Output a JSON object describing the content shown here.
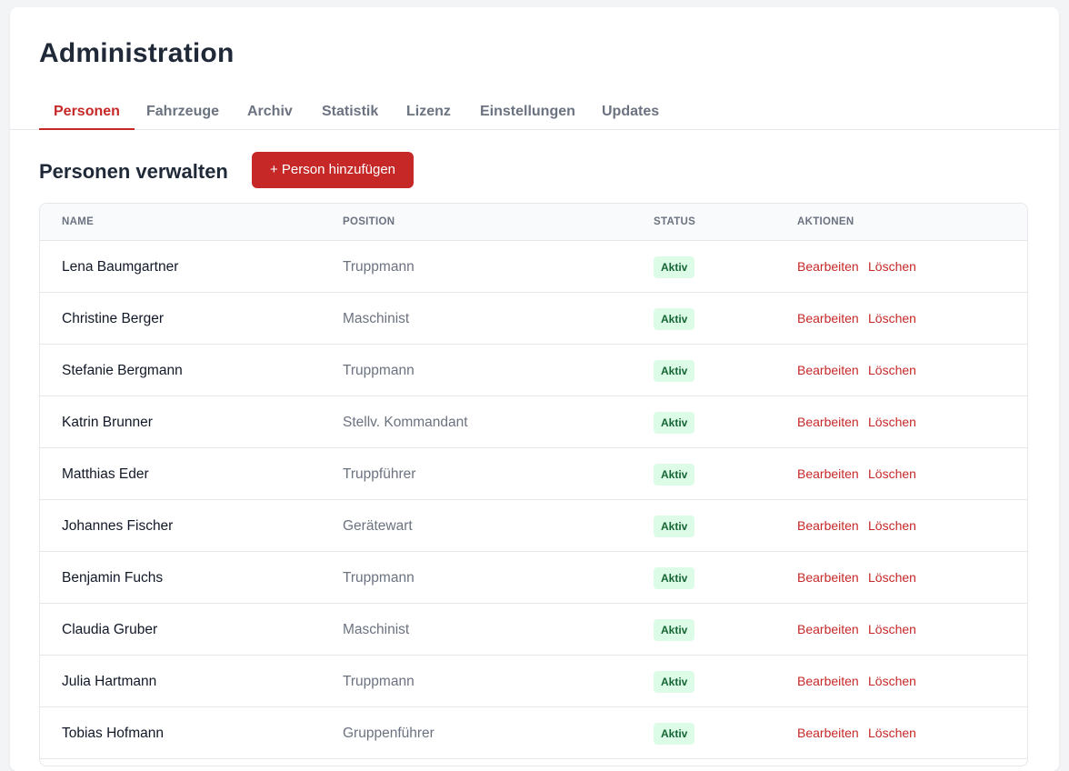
{
  "page": {
    "title": "Administration"
  },
  "tabs": [
    {
      "label": "Personen",
      "active": true
    },
    {
      "label": "Fahrzeuge"
    },
    {
      "label": "Archiv"
    },
    {
      "label": "Statistik"
    },
    {
      "label": "Lizenz"
    },
    {
      "label": "Einstellungen"
    },
    {
      "label": "Updates"
    }
  ],
  "section": {
    "title": "Personen verwalten",
    "add_button": "+ Person hinzufügen"
  },
  "table": {
    "headers": {
      "name": "NAME",
      "position": "POSITION",
      "status": "STATUS",
      "actions": "AKTIONEN"
    },
    "rows": [
      {
        "name": "Lena Baumgartner",
        "position": "Truppmann",
        "status": "Aktiv",
        "edit": "Bearbeiten",
        "delete": "Löschen"
      },
      {
        "name": "Christine Berger",
        "position": "Maschinist",
        "status": "Aktiv",
        "edit": "Bearbeiten",
        "delete": "Löschen"
      },
      {
        "name": "Stefanie Bergmann",
        "position": "Truppmann",
        "status": "Aktiv",
        "edit": "Bearbeiten",
        "delete": "Löschen"
      },
      {
        "name": "Katrin Brunner",
        "position": "Stellv. Kommandant",
        "status": "Aktiv",
        "edit": "Bearbeiten",
        "delete": "Löschen"
      },
      {
        "name": "Matthias Eder",
        "position": "Truppführer",
        "status": "Aktiv",
        "edit": "Bearbeiten",
        "delete": "Löschen"
      },
      {
        "name": "Johannes Fischer",
        "position": "Gerätewart",
        "status": "Aktiv",
        "edit": "Bearbeiten",
        "delete": "Löschen"
      },
      {
        "name": "Benjamin Fuchs",
        "position": "Truppmann",
        "status": "Aktiv",
        "edit": "Bearbeiten",
        "delete": "Löschen"
      },
      {
        "name": "Claudia Gruber",
        "position": "Maschinist",
        "status": "Aktiv",
        "edit": "Bearbeiten",
        "delete": "Löschen"
      },
      {
        "name": "Julia Hartmann",
        "position": "Truppmann",
        "status": "Aktiv",
        "edit": "Bearbeiten",
        "delete": "Löschen"
      },
      {
        "name": "Tobias Hofmann",
        "position": "Gruppenführer",
        "status": "Aktiv",
        "edit": "Bearbeiten",
        "delete": "Löschen"
      }
    ]
  },
  "colors": {
    "accent": "#c62828",
    "badge_bg": "#dcfce7",
    "badge_text": "#166534"
  }
}
